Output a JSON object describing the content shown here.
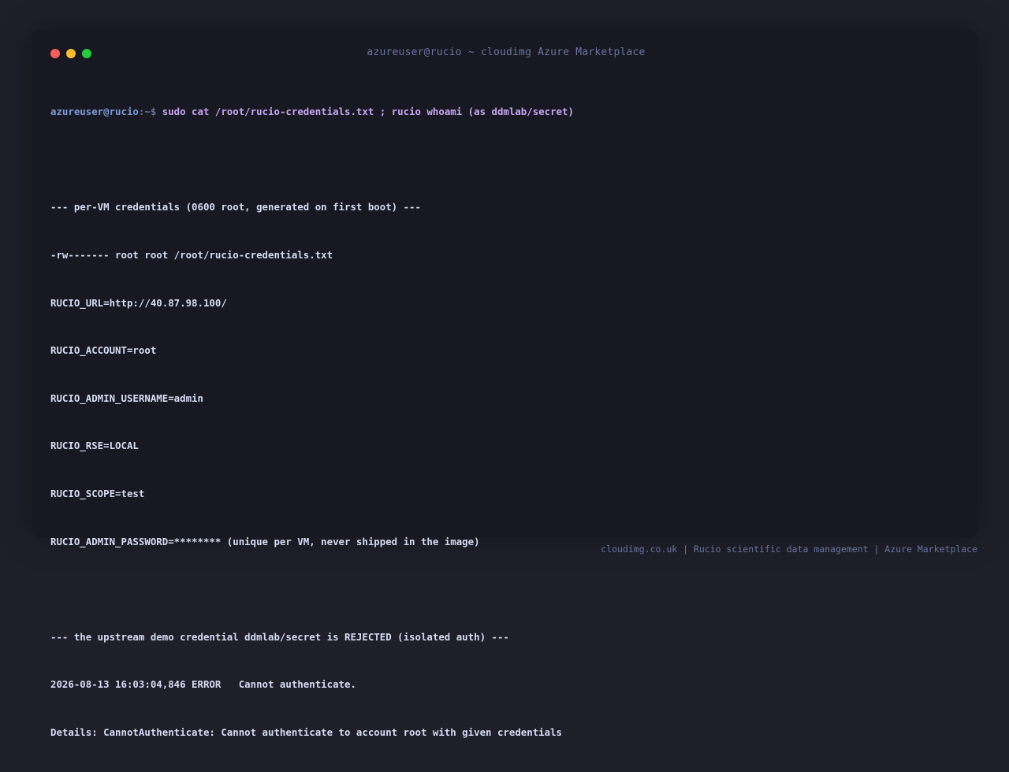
{
  "window": {
    "title": "azureuser@rucio ~ cloudimg Azure Marketplace",
    "controls": {
      "close_color": "#ff5f57",
      "minimize_color": "#febc2e",
      "maximize_color": "#28c840"
    }
  },
  "terminal": {
    "prompt_user": "azureuser@rucio",
    "prompt_path": ":~$ ",
    "command": "sudo cat /root/rucio-credentials.txt ; rucio whoami (as ddmlab/secret)",
    "section1_header": "--- per-VM credentials (0600 root, generated on first boot) ---",
    "file_listing": "-rw------- root root /root/rucio-credentials.txt",
    "credentials": [
      "RUCIO_URL=http://40.87.98.100/",
      "RUCIO_ACCOUNT=root",
      "RUCIO_ADMIN_USERNAME=admin",
      "RUCIO_RSE=LOCAL",
      "RUCIO_SCOPE=test",
      "RUCIO_ADMIN_PASSWORD=******** (unique per VM, never shipped in the image)"
    ],
    "section2_header": "--- the upstream demo credential ddmlab/secret is REJECTED (isolated auth) ---",
    "error_line": "2026-08-13 16:03:04,846 ERROR   Cannot authenticate.",
    "details_line": "Details: CannotAuthenticate: Cannot authenticate to account root with given credentials"
  },
  "footer": {
    "text": "cloudimg.co.uk | Rucio scientific data management | Azure Marketplace"
  }
}
